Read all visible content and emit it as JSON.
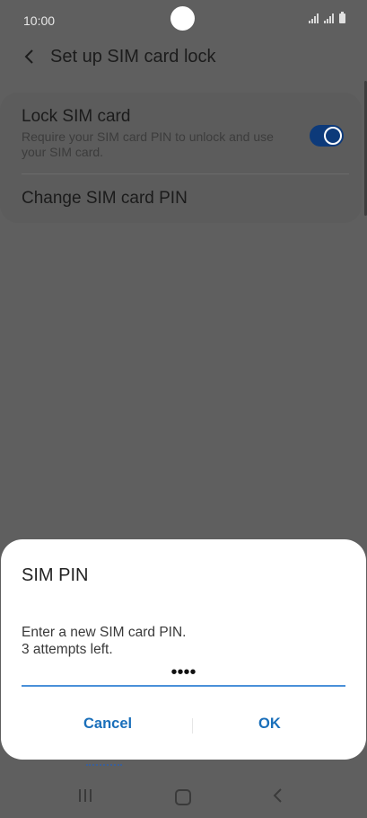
{
  "status_bar": {
    "time": "10:00"
  },
  "header": {
    "title": "Set up SIM card lock"
  },
  "settings": {
    "lock_sim": {
      "title": "Lock SIM card",
      "subtitle": "Require your SIM card PIN to unlock and use your SIM card.",
      "enabled": true
    },
    "change_pin": {
      "title": "Change SIM card PIN"
    }
  },
  "dialog": {
    "title": "SIM PIN",
    "message_line1": "Enter a new SIM card PIN.",
    "message_line2": "3 attempts left.",
    "pin_value": "••••",
    "cancel_label": "Cancel",
    "ok_label": "OK"
  },
  "colors": {
    "accent": "#1a6fba",
    "toggle_on": "#0d3a7a",
    "input_underline": "#4a90d9",
    "scrim": "#5f5f5f"
  }
}
